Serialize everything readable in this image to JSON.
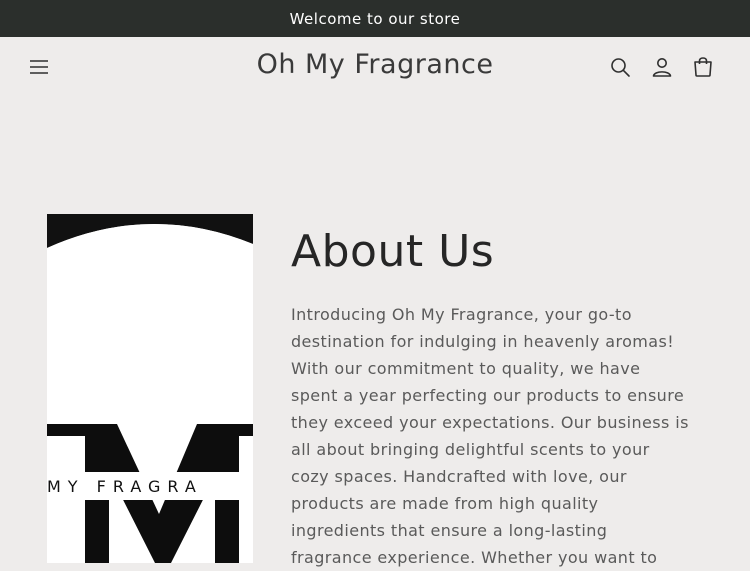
{
  "announcement": {
    "text": "Welcome to our store"
  },
  "header": {
    "brand": "Oh My Fragrance",
    "icons": {
      "menu": "hamburger-menu-icon",
      "search": "search-icon",
      "account": "user-icon",
      "cart": "cart-icon"
    }
  },
  "about": {
    "title": "About Us",
    "body": "Introducing Oh My Fragrance, your go-to destination for indulging in heavenly aromas! With our commitment to quality, we have spent a year perfecting our products to ensure they exceed your expectations. Our business is all about bringing delightful scents to your cozy spaces. Handcrafted with love, our products are made from high quality ingredients that ensure a long-lasting fragrance experience. Whether you want to",
    "image": {
      "logo_text": "MY FRAGRA"
    }
  },
  "colors": {
    "announcement_bg": "#2b2f2c",
    "page_bg": "#eeeceb",
    "text": "#2f2f2f",
    "body_text": "#5a5a5a"
  }
}
